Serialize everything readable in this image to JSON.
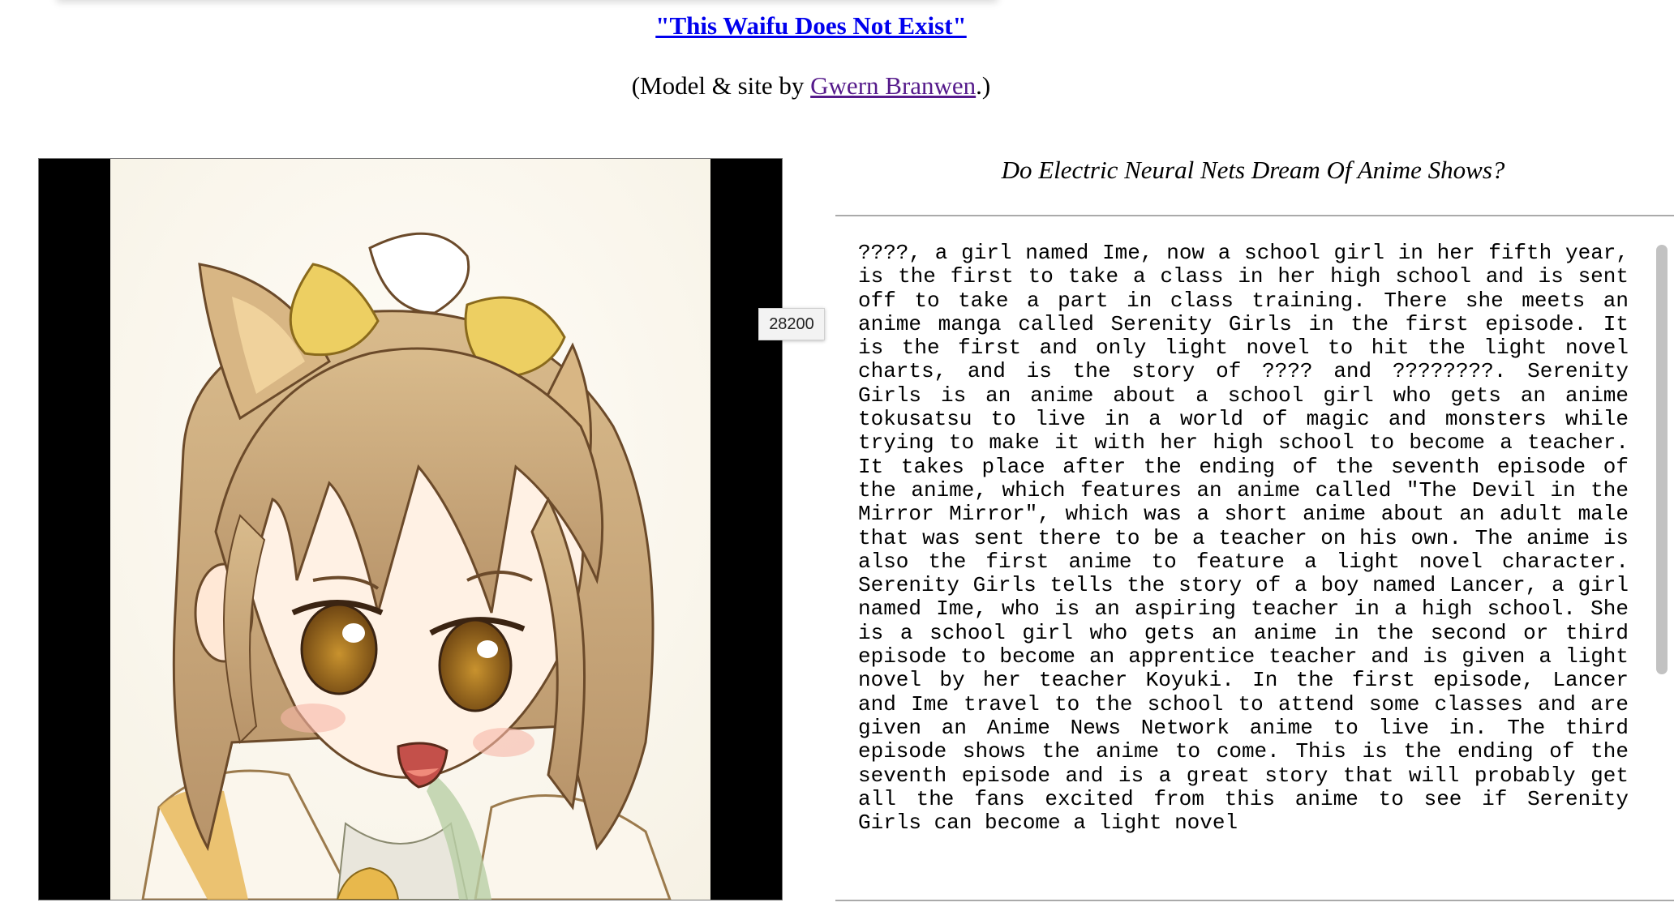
{
  "header": {
    "title": "\"This Waifu Does Not Exist\"",
    "byline_prefix": "(Model & site by ",
    "byline_author": "Gwern Branwen",
    "byline_suffix": ".)"
  },
  "image": {
    "tooltip": "28200"
  },
  "story": {
    "heading": "Do Electric Neural Nets Dream Of Anime Shows?",
    "text": "????, a girl named Ime, now a school girl in her fifth year, is the first to take a class in her high school and is sent off to take a part in class training. There she meets an anime manga called Serenity Girls in the first episode. It is the first and only light novel to hit the light novel charts, and is the story of ???? and ????????. Serenity Girls is an anime about a school girl who gets an anime tokusatsu to live in a world of magic and monsters while trying to make it with her high school to become a teacher. It takes place after the ending of the seventh episode of the anime, which features an anime called \"The Devil in the Mirror Mirror\", which was a short anime about an adult male that was sent there to be a teacher on his own. The anime is also the first anime to feature a light novel character. Serenity Girls tells the story of a boy named Lancer, a girl named Ime, who is an aspiring teacher in a high school. She is a school girl who gets an anime in the second or third episode to become an apprentice teacher and is given a light novel by her teacher Koyuki. In the first episode, Lancer and Ime travel to the school to attend some classes and are given an Anime News Network anime to live in. The third episode shows the anime to come. This is the ending of the seventh episode and is a great story that will probably get all the fans excited from this anime to see if Serenity Girls can become a light novel"
  },
  "colors": {
    "link": "#0000ee",
    "visited_link": "#551a8b",
    "hair": "#c9a77a",
    "eyes": "#9a6a1e"
  }
}
